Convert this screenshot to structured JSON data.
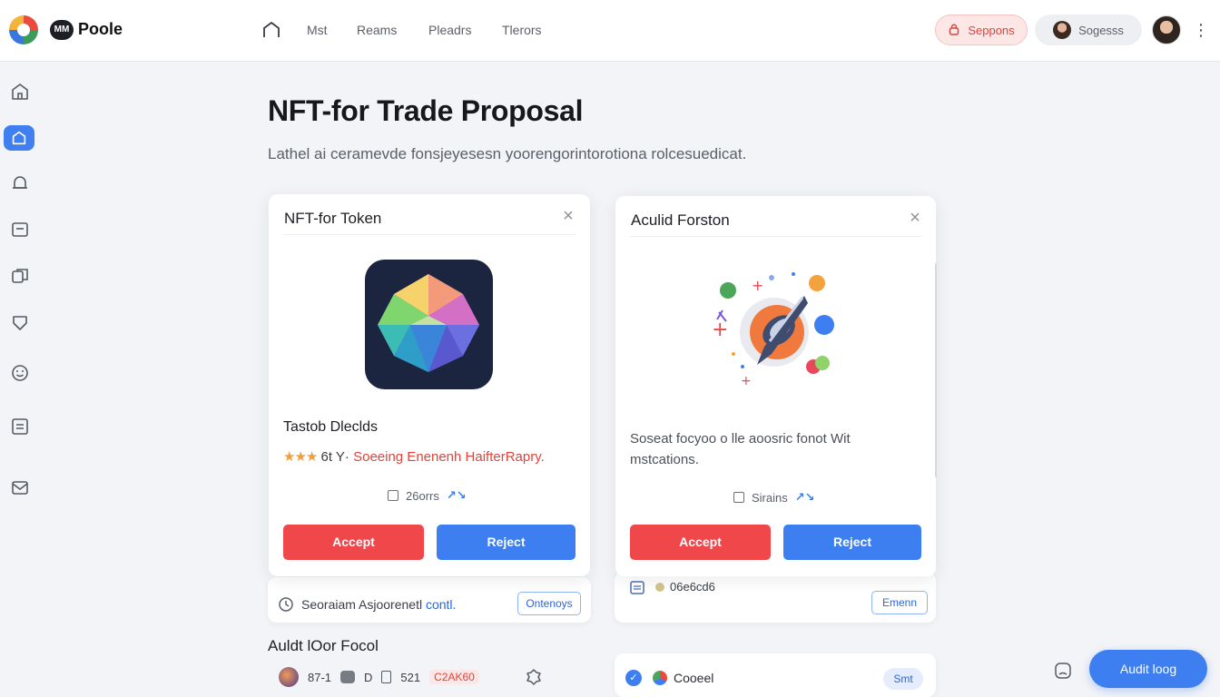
{
  "topbar": {
    "brand_badge": "MM",
    "brand_name": "Poole",
    "nav": [
      "Mst",
      "Reams",
      "Pleadrs",
      "Tlerors"
    ],
    "alert_button": "Seppons",
    "profile_button": "Sogesss",
    "more": "⋮"
  },
  "sidebar": {
    "items": [
      "home-icon",
      "dashboard-icon",
      "bell-icon",
      "inbox-icon",
      "copy-icon",
      "shield-icon",
      "smile-icon",
      "list-icon",
      "mail-icon"
    ]
  },
  "page": {
    "title": "NFT-for Trade Proposal",
    "subtitle": "Lathel ai ceramevde fonsjeyesesn yoorengorintorotiona rolcesuedicat."
  },
  "card_left": {
    "title": "NFT-for Token",
    "close": "×",
    "item_name": "Tastob Dleclds",
    "stars": "★★★",
    "rating_desc_dark": "6t  Y·",
    "rating_desc_accent": "Soeeing Enenenh HaifterRapry.",
    "meta_label": "26orrs",
    "trend": "↗↘",
    "accept": "Accept",
    "reject": "Reject"
  },
  "card_right": {
    "title": "Aculid Forston",
    "close": "×",
    "description": "Soseat focyoo o lle aoosric fonot Wit mstcations.",
    "meta_label": "Sirains",
    "trend": "↗↘",
    "accept": "Accept",
    "reject": "Reject"
  },
  "footer_left": {
    "text_dark": "Seoraiam  Asjoorenetl",
    "text_link": "contl.",
    "button": "Ontenoys"
  },
  "footer_right": {
    "text": "06e6cd6",
    "button": "Emenn"
  },
  "audit": {
    "title": "Auldt lOor Focol",
    "row": {
      "val1": "87-1",
      "val2": "D",
      "val3": "521",
      "badge": "C2AK60"
    },
    "right_row_label": "Cooeel",
    "right_row_button": "Smt",
    "log_button": "Audit loog"
  },
  "colors": {
    "accept": "#f0474b",
    "reject": "#3d7ff0",
    "accent_text": "#e0443c",
    "link": "#2c66d8"
  }
}
